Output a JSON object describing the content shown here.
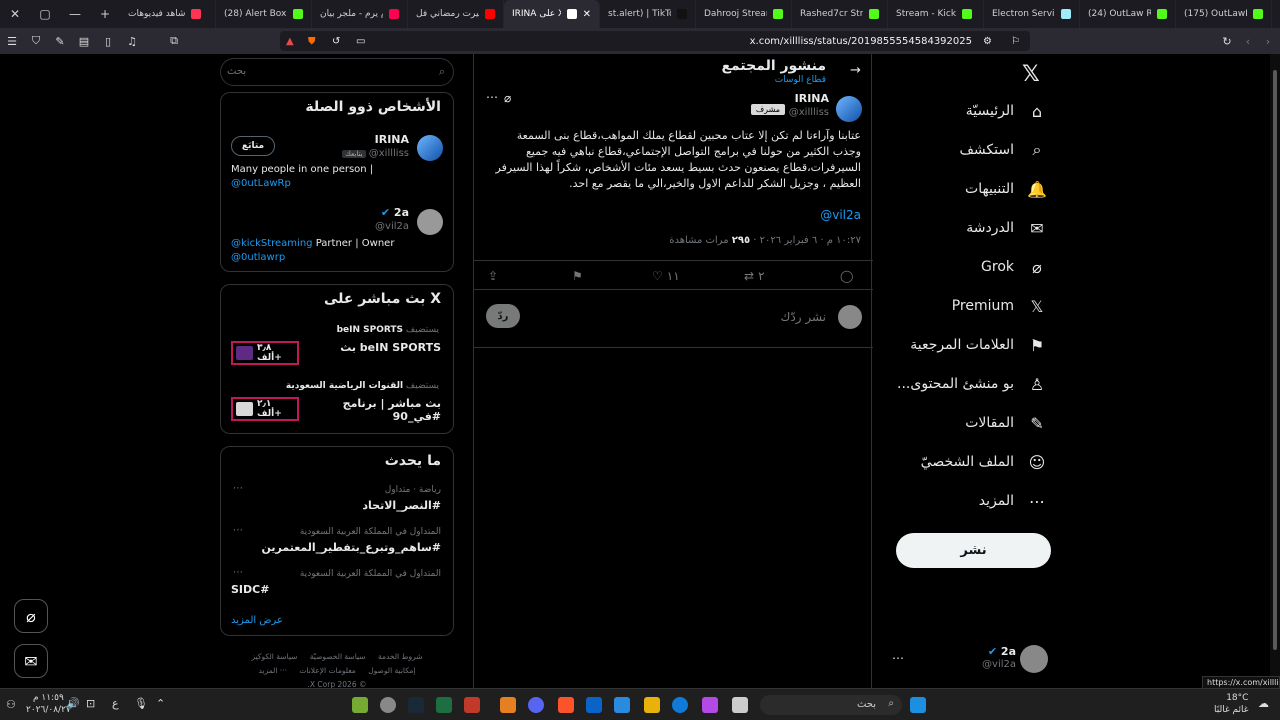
{
  "browser": {
    "tabs": [
      {
        "title": "شاهد فيديوهات",
        "fav_color": "#ff3355"
      },
      {
        "title": "(28) Alert Box / St",
        "fav_color": "#53fc18"
      },
      {
        "title": "يرم يرم - ملجر بيان",
        "fav_color": "#ff0050"
      },
      {
        "title": "اليرت رمضاني فل",
        "fav_color": "#ff0000"
      },
      {
        "title": "IRINA على X: ...",
        "fav_color": "#ffffff"
      },
      {
        "title": "st.alert) | TikTok",
        "fav_color": "#111111"
      },
      {
        "title": "Dahrooj Stream",
        "fav_color": "#53fc18"
      },
      {
        "title": "Rashed7cr Stream",
        "fav_color": "#53fc18"
      },
      {
        "title": "Stream - Kick",
        "fav_color": "#53fc18"
      },
      {
        "title": "Electron Services",
        "fav_color": "#9feaf9"
      },
      {
        "title": "(24) OutLaw RD",
        "fav_color": "#53fc18"
      },
      {
        "title": "(175) OutLawRp",
        "fav_color": "#53fc18"
      }
    ],
    "url": "x.com/xillliss/status/2019855554584392025",
    "status_url": "https://x.com/xillliss"
  },
  "nav": {
    "items": [
      {
        "label": "الرئيسيّة",
        "icon": "home-icon",
        "glyph": "⌂"
      },
      {
        "label": "استكشف",
        "icon": "search-icon",
        "glyph": "⌕"
      },
      {
        "label": "التنبيهات",
        "icon": "bell-icon",
        "glyph": "🔔"
      },
      {
        "label": "الدردشة",
        "icon": "mail-icon",
        "glyph": "✉"
      },
      {
        "label": "Grok",
        "icon": "grok-icon",
        "glyph": "⌀"
      },
      {
        "label": "Premium",
        "icon": "x-premium-icon",
        "glyph": "𝕏"
      },
      {
        "label": "العلامات المرجعية",
        "icon": "bookmark-icon",
        "glyph": "⚑"
      },
      {
        "label": "...بو منشئ المحتوى",
        "icon": "creator-icon",
        "glyph": "♙"
      },
      {
        "label": "المقالات",
        "icon": "article-icon",
        "glyph": "✎"
      },
      {
        "label": "الملف الشخصيّ",
        "icon": "profile-icon",
        "glyph": "☺"
      },
      {
        "label": "المزيد",
        "icon": "more-icon",
        "glyph": "⋯"
      }
    ],
    "post_label": "نشر",
    "account": {
      "name": "2a",
      "handle": "@vil2a"
    }
  },
  "post": {
    "header_title": "منشور المجتمع",
    "header_subtitle": "قطاع الوسات",
    "author_name": "IRINA",
    "author_handle": "@xillliss",
    "author_badge": "مشرف",
    "body": "عتابنا وآراءنا لم تكن إلا عتاب محبين لقطاع يملك المواهب،قطاع بنى السمعة وجذب الكثير من حولنا في برامج التواصل الإجتماعي،قطاع نباهي فيه جميع السيرفرات،قطاع يصنعون حدث بسيط يسعد مئات الأشخاص، شكراً لهذا السيرفر العظيم ، وجزيل الشكر للداعم الاول والخير،الي ما يقصر مع احد.",
    "mention": "@vil2a",
    "time": "١٠:٢٧ م · ٦ فبراير ٢٠٢٦",
    "views_count": "٢٩٥",
    "views_label": "مرات مشاهدة",
    "likes": "١١",
    "reposts": "٢",
    "reply_placeholder": "نشر ردّك",
    "reply_button": "ردّ"
  },
  "sidebar": {
    "search_placeholder": "بحث",
    "people_title": "الأشخاص ذوو الصلة",
    "people": [
      {
        "name": "IRINA",
        "handle": "@xillliss",
        "tag": "يتابعك",
        "bio": "Many people in one person |",
        "bio_mention": "@0utLawRp",
        "follow": "متابَع"
      },
      {
        "name": "2a",
        "handle": "@vil2a",
        "bio_mention_1": "@kickStreaming",
        "bio_text": "Partner | Owner",
        "bio_mention_2": "@0utlawrp"
      }
    ],
    "live_title": "X بث مباشر على",
    "live": [
      {
        "host_label": "يستضيف",
        "host": "beIN SPORTS",
        "title": "beIN SPORTS بث",
        "count": "٣٫٨ ألف+",
        "thumb_color": "#5e2a84"
      },
      {
        "host_label": "يستضيف",
        "host": "القنوات الرياضية السعودية",
        "title": "بث مباشر | برنامج #في_90",
        "count": "٢٫١ ألف+",
        "thumb_color": "#d8d8d8"
      }
    ],
    "trends_title": "ما يحدث",
    "trends": [
      {
        "meta": "رياضة · متداول",
        "name": "#النصر_الاتحاد"
      },
      {
        "meta": "المتداول في المملكة العربية السعودية",
        "name": "#ساهم_وتبرع_بتفطير_المعتمرين"
      },
      {
        "meta": "المتداول في المملكة العربية السعودية",
        "name": "#SIDC"
      }
    ],
    "show_more": "عرض المزيد",
    "footer": [
      "شروط الخدمة",
      "سياسة الخصوصيّة",
      "سياسة الكوكيز",
      "إمكانية الوصول",
      "معلومات الإعلانات",
      "··· المزيد",
      "© 2026 X Corp."
    ]
  },
  "taskbar": {
    "search": "بحث",
    "time": "١١:٥٩ م",
    "date": "٢٠٢٦/٠٨/٢٧",
    "temp": "18°C",
    "weather": "غائم غالبًا",
    "lang": "ع"
  }
}
